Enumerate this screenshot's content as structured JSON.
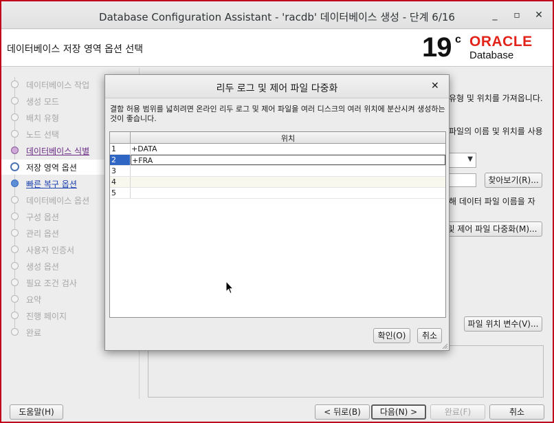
{
  "window": {
    "title": "Database Configuration Assistant - 'racdb' 데이터베이스 생성 - 단계 6/16",
    "minimize": "_",
    "maximize": "▫",
    "close": "✕"
  },
  "header": {
    "page_title": "데이터베이스 저장 영역 옵션 선택",
    "logo_version": "19",
    "logo_c": "c",
    "logo_oracle": "ORACLE",
    "logo_database": "Database"
  },
  "sidebar": {
    "steps": [
      {
        "label": "데이터베이스 작업",
        "state": "done"
      },
      {
        "label": "생성 모드",
        "state": "done"
      },
      {
        "label": "배치 유형",
        "state": "done"
      },
      {
        "label": "노드 선택",
        "state": "done"
      },
      {
        "label": "데이터베이스 식별",
        "state": "visited"
      },
      {
        "label": "저장 영역 옵션",
        "state": "current"
      },
      {
        "label": "빠른 복구 옵션",
        "state": "link"
      },
      {
        "label": "데이터베이스 옵션",
        "state": "pending"
      },
      {
        "label": "구성 옵션",
        "state": "pending"
      },
      {
        "label": "관리 옵션",
        "state": "pending"
      },
      {
        "label": "사용자 인증서",
        "state": "pending"
      },
      {
        "label": "생성 옵션",
        "state": "pending"
      },
      {
        "label": "필요 조건 검사",
        "state": "pending"
      },
      {
        "label": "요약",
        "state": "pending"
      },
      {
        "label": "진행 페이지",
        "state": "pending"
      },
      {
        "label": "완료",
        "state": "pending"
      }
    ]
  },
  "content": {
    "text_1": "유형 및 위치를 가져옵니다.",
    "text_2": "파일의 이름 및 위치를 사용",
    "text_3": "해 데이터 파일 이름을 자",
    "browse_button": "찾아보기(R)...",
    "multiplex_button": "및 제어 파일 다중화(M)...",
    "file_location_vars_button": "파일 위치 변수(V)..."
  },
  "footer": {
    "help_button": "도움말(H)",
    "back_button": "< 뒤로(B)",
    "next_button": "다음(N) >",
    "finish_button": "완료(F)",
    "cancel_button": "취소"
  },
  "dialog": {
    "title": "리두 로그 및 제어 파일 다중화",
    "close": "✕",
    "description": "결함 허용 범위를 넓히려면 온라인 리두 로그 및 제어 파일을 여러 디스크의 여러 위치에 분산시켜 생성하는 것이 좋습니다.",
    "column_header": "위치",
    "rows": [
      {
        "num": "1",
        "value": "+DATA"
      },
      {
        "num": "2",
        "value": "+FRA"
      },
      {
        "num": "3",
        "value": ""
      },
      {
        "num": "4",
        "value": ""
      },
      {
        "num": "5",
        "value": ""
      }
    ],
    "ok_button": "확인(O)",
    "cancel_button": "취소"
  }
}
